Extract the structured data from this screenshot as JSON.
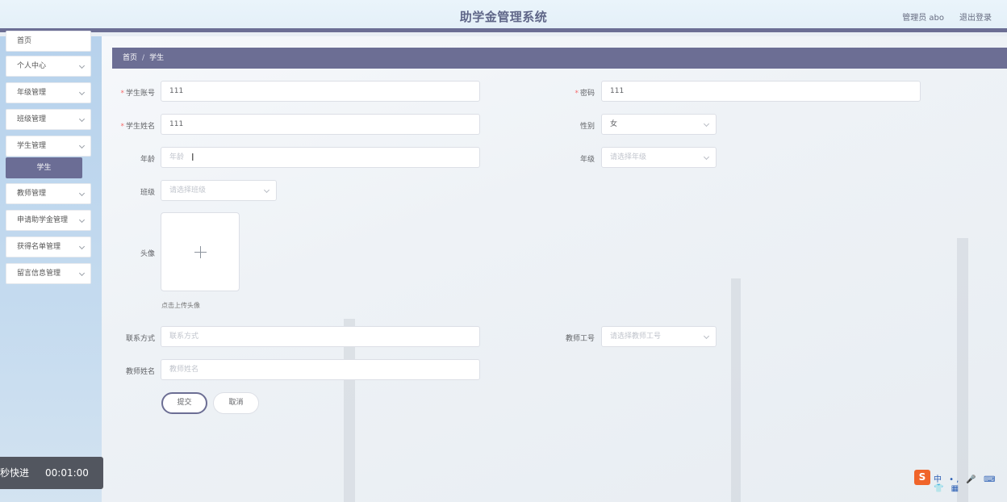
{
  "header": {
    "title": "助学金管理系统",
    "user": "管理员 abo",
    "logout": "退出登录"
  },
  "sidebar": {
    "items": [
      {
        "label": "首页"
      },
      {
        "label": "个人中心"
      },
      {
        "label": "年级管理"
      },
      {
        "label": "班级管理"
      },
      {
        "label": "学生管理"
      },
      {
        "label": "教师管理"
      },
      {
        "label": "申请助学金管理"
      },
      {
        "label": "获得名单管理"
      },
      {
        "label": "留言信息管理"
      }
    ],
    "active_sub": "学生"
  },
  "breadcrumb": {
    "home": "首页",
    "separator": "/",
    "current": "学生"
  },
  "form": {
    "student_account": {
      "label": "学生账号",
      "value": "111",
      "required": true
    },
    "password": {
      "label": "密码",
      "value": "111",
      "required": true
    },
    "student_name": {
      "label": "学生姓名",
      "value": "111",
      "required": true
    },
    "gender": {
      "label": "性别",
      "value": "女"
    },
    "age": {
      "label": "年龄",
      "placeholder": "年龄"
    },
    "grade": {
      "label": "年级",
      "placeholder": "请选择年级"
    },
    "class": {
      "label": "班级",
      "placeholder": "请选择班级"
    },
    "avatar": {
      "label": "头像",
      "tip": "点击上传头像"
    },
    "contact": {
      "label": "联系方式",
      "placeholder": "联系方式"
    },
    "teacher_id": {
      "label": "教师工号",
      "placeholder": "请选择教师工号"
    },
    "teacher_name": {
      "label": "教师姓名",
      "placeholder": "教师姓名"
    },
    "submit": "提交",
    "cancel": "取消"
  },
  "overlay": {
    "label": "秒快进",
    "time": "00:01:00"
  },
  "ime": {
    "logo": "S",
    "glyphs": "中 •, 🎤 ⌨ 👕 ▦"
  },
  "colors": {
    "accent": "#6c6e94",
    "required": "#f56c6c"
  }
}
